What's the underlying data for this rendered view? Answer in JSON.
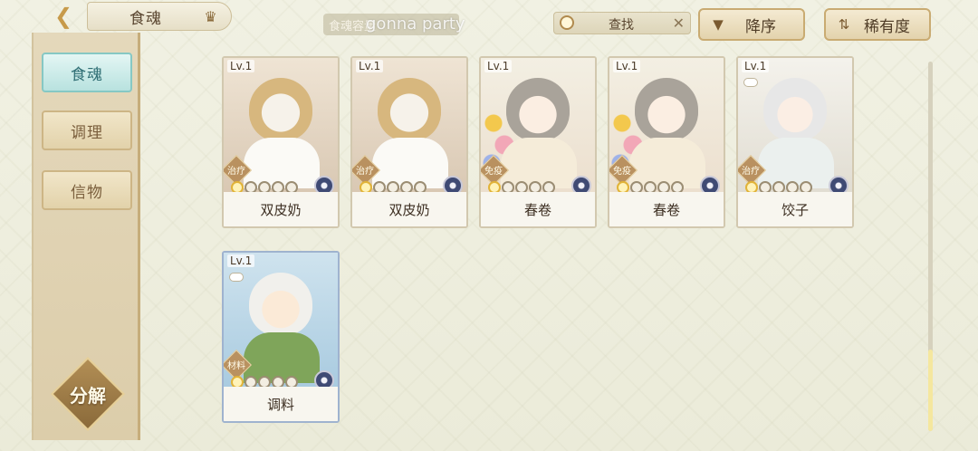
{
  "header": {
    "back_icon": "back-arrow-icon",
    "title": "食魂",
    "capacity_label": "食魂容量",
    "watermark": "gonna party",
    "search_label": "查找",
    "sort_desc_label": "降序",
    "sort_rarity_label": "稀有度"
  },
  "sidebar": {
    "tabs": [
      {
        "label": "食魂",
        "active": true
      },
      {
        "label": "调理",
        "active": false
      },
      {
        "label": "信物",
        "active": false
      }
    ],
    "decompose_label": "分解"
  },
  "cards": [
    {
      "level": "Lv.1",
      "type": "治疗",
      "name": "双皮奶",
      "stars": 1
    },
    {
      "level": "Lv.1",
      "type": "治疗",
      "name": "双皮奶",
      "stars": 1
    },
    {
      "level": "Lv.1",
      "type": "免疫",
      "name": "春卷",
      "stars": 1
    },
    {
      "level": "Lv.1",
      "type": "免疫",
      "name": "春卷",
      "stars": 1
    },
    {
      "level": "Lv.1",
      "type": "治疗",
      "name": "饺子",
      "stars": 1
    },
    {
      "level": "Lv.1",
      "type": "材料",
      "name": "调料",
      "stars": 1
    }
  ],
  "colors": {
    "accent_teal": "#86c8c4",
    "gold": "#e1b338",
    "frame_brown": "#c6ad7b"
  }
}
